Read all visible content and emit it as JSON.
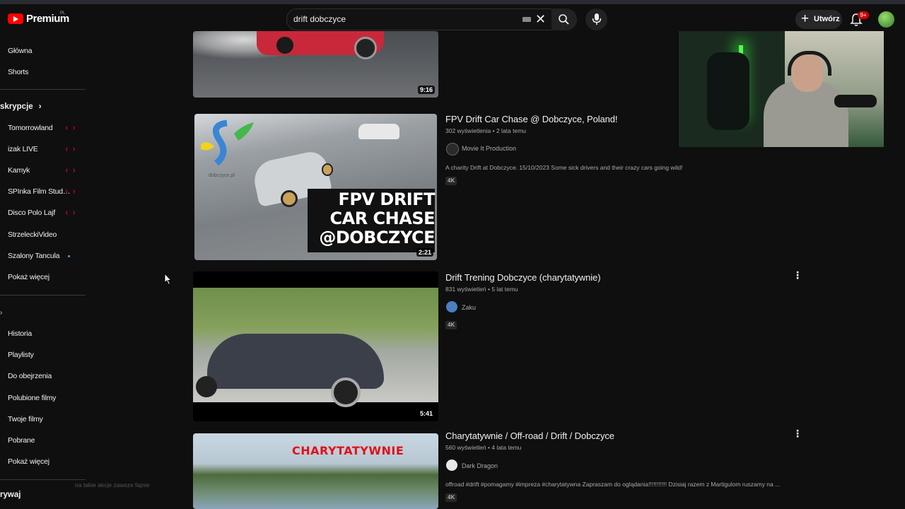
{
  "header": {
    "logo_text": "Premium",
    "country_code": "PL",
    "search_value": "drift dobczyce",
    "create_label": "Utwórz",
    "notification_count": "9+"
  },
  "sidebar": {
    "top_items": [
      "Główna",
      "Shorts"
    ],
    "subscriptions_heading": "skrypcje",
    "subscriptions": [
      {
        "label": "Tomorrowland",
        "indicator": "live"
      },
      {
        "label": "izak LIVE",
        "indicator": "live"
      },
      {
        "label": "Kamyk",
        "indicator": "live"
      },
      {
        "label": "SPInka Film Stud…",
        "indicator": "live"
      },
      {
        "label": "Disco Polo Lajf",
        "indicator": "live"
      },
      {
        "label": "StrzeleckiVideo",
        "indicator": "none"
      },
      {
        "label": "Szalony Tancula",
        "indicator": "new"
      },
      {
        "label": "Pokaż więcej",
        "indicator": "none"
      }
    ],
    "you_items": [
      "Historia",
      "Playlisty",
      "Do obejrzenia",
      "Polubione filmy",
      "Twoje filmy",
      "Pobrane",
      "Pokaż więcej"
    ],
    "bottom_heading": "rywaj"
  },
  "results": [
    {
      "duration": "9:16"
    },
    {
      "title": "FPV Drift Car Chase @ Dobczyce, Poland!",
      "meta": "302 wyświetlenia • 2 lata temu",
      "channel": "Movie It Production",
      "description": "A charity Drift at Dobczyce. 15/10/2023 Some sick drivers and their crazy cars going wild!",
      "badge": "4K",
      "duration": "2:21",
      "thumb_text": [
        "FPV DRIFT",
        "CAR CHASE",
        "@DOBCZYCE"
      ],
      "thumb_logo": "dobczyce.pl"
    },
    {
      "title": "Drift Trening Dobczyce (charytatywnie)",
      "meta": "831 wyświetleń • 5 lat temu",
      "channel": "Zaku",
      "badge": "4K",
      "duration": "5:41"
    },
    {
      "title": "Charytatywnie / Off-road / Drift / Dobczyce",
      "meta": "560 wyświetleń • 4 lata temu",
      "channel": "Dark Dragon",
      "description": "offroad #drift #pomagamy #impreza #charytatywna Zapraszam do oglądania!!!!!!!!!!! Dzisiaj razem z Martigulom ruszamy na ...",
      "badge": "4K",
      "thumb_text": "CHARYTATYWNIE"
    }
  ],
  "overlay_chat": "na takie akcje zawsze fajnie",
  "colors": {
    "background": "#0f0f0f",
    "brand_red": "#ff0000",
    "live_red": "#a0002a",
    "new_blue": "#3ea6ff"
  }
}
